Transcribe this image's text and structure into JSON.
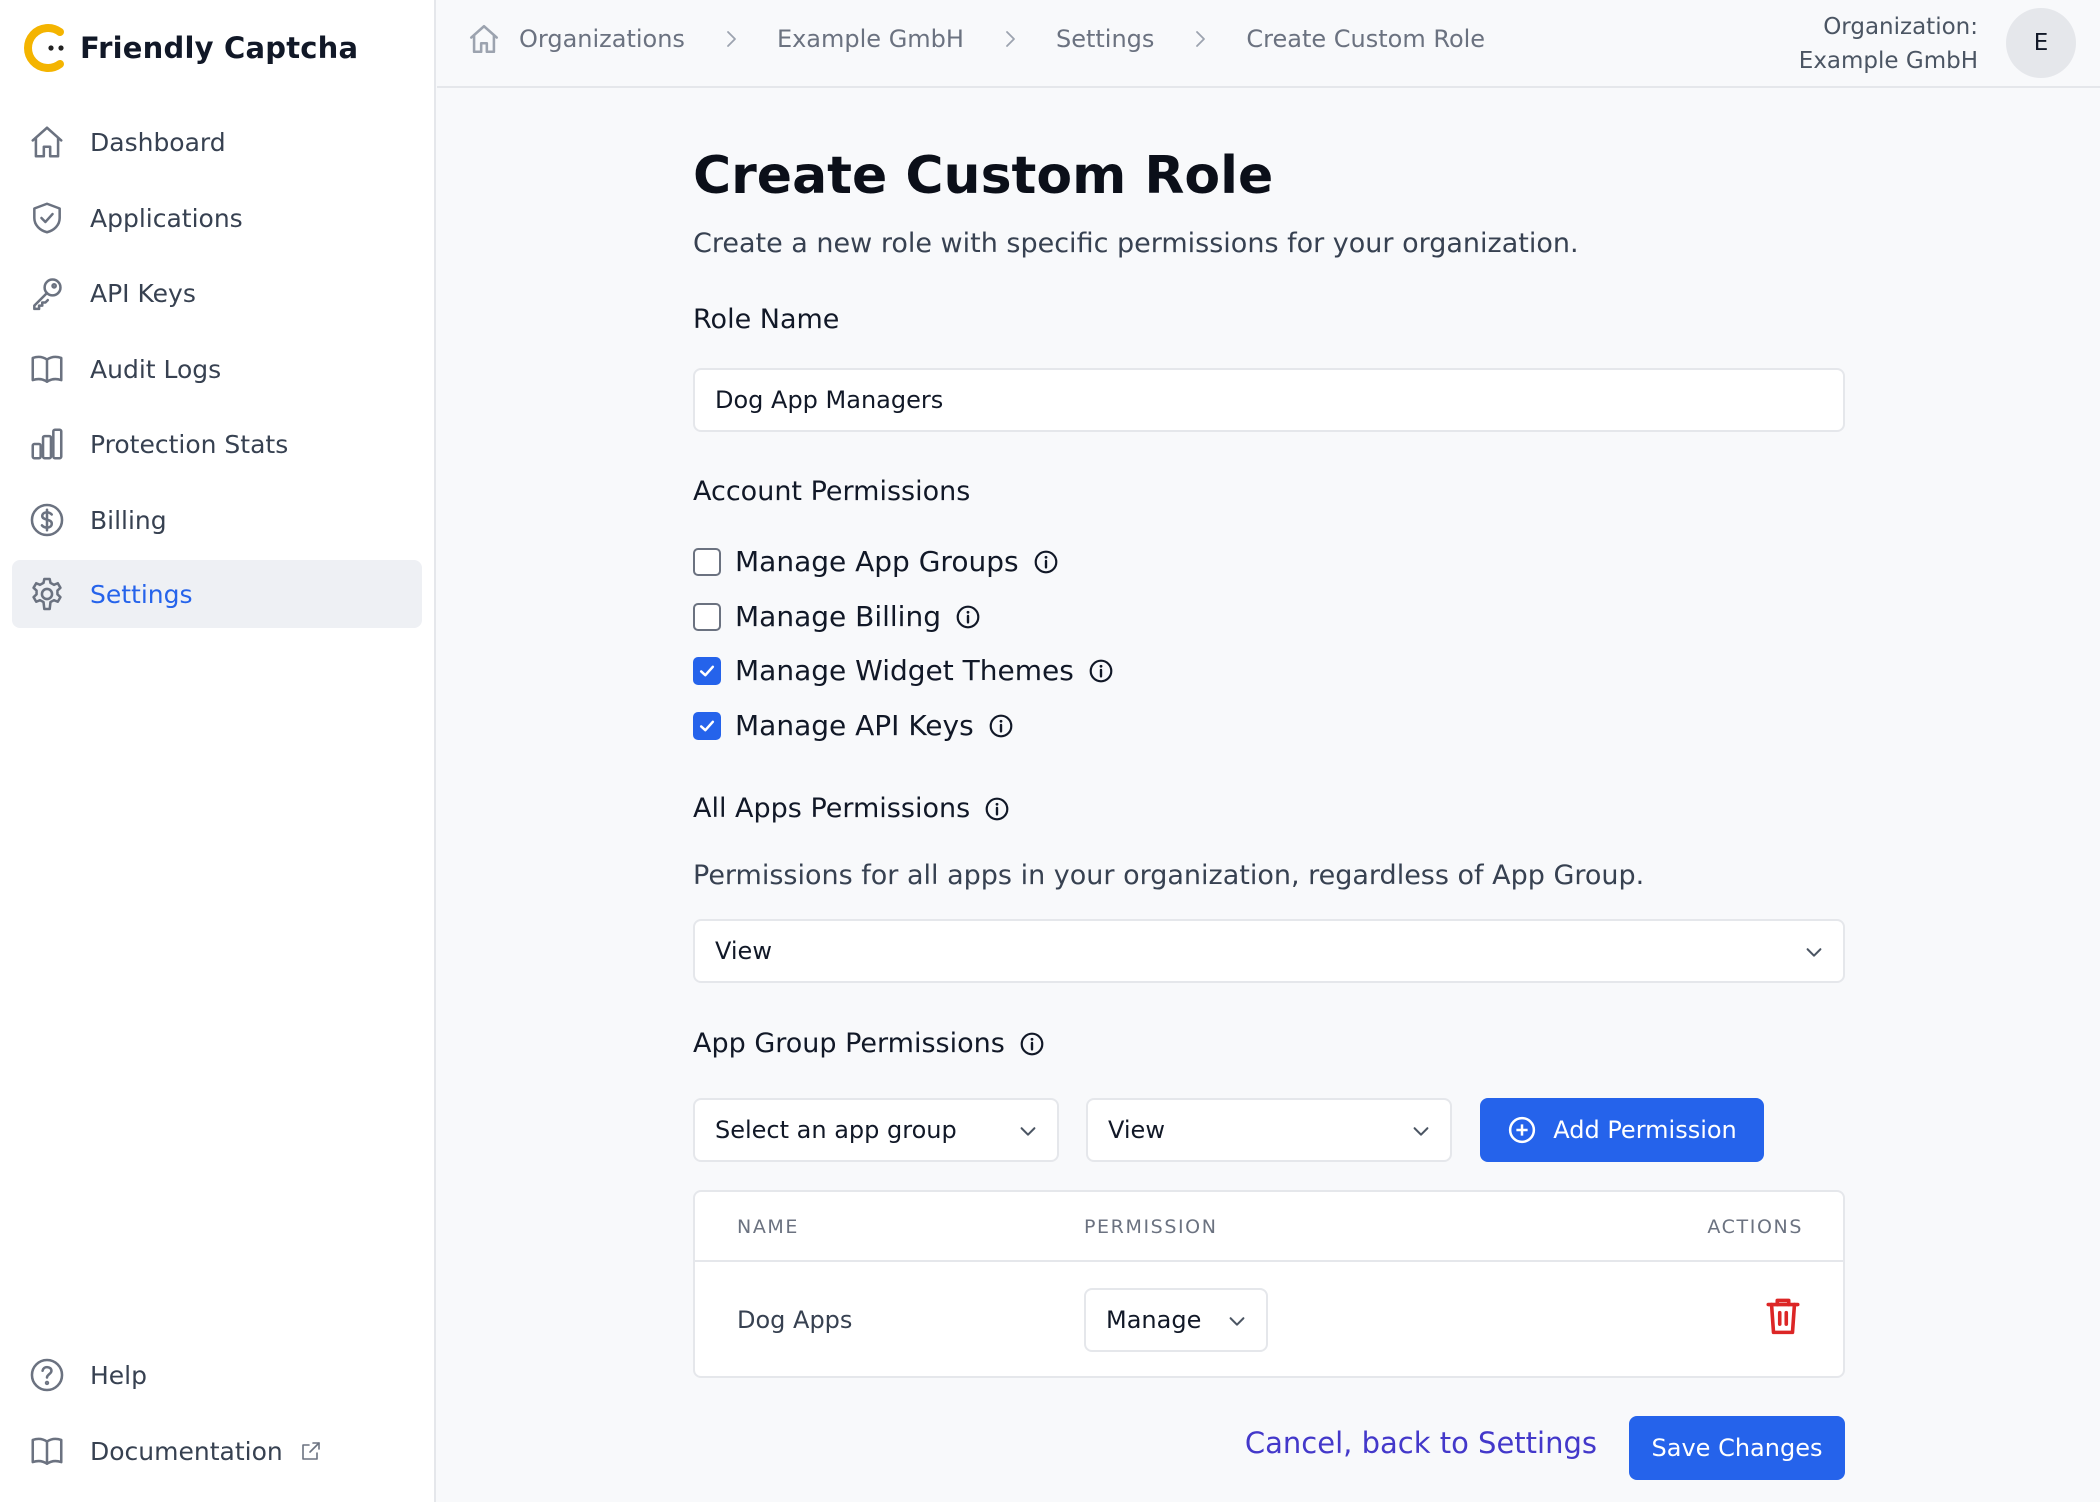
{
  "brand": {
    "name": "Friendly Captcha",
    "accent": "#f4b400"
  },
  "sidebar": {
    "items": [
      {
        "label": "Dashboard",
        "icon": "home-icon"
      },
      {
        "label": "Applications",
        "icon": "shield-check-icon"
      },
      {
        "label": "API Keys",
        "icon": "key-icon"
      },
      {
        "label": "Audit Logs",
        "icon": "book-icon"
      },
      {
        "label": "Protection Stats",
        "icon": "bar-chart-icon"
      },
      {
        "label": "Billing",
        "icon": "dollar-circle-icon"
      },
      {
        "label": "Settings",
        "icon": "gear-icon",
        "active": true
      }
    ],
    "bottom": [
      {
        "label": "Help",
        "icon": "question-circle-icon"
      },
      {
        "label": "Documentation",
        "icon": "book-icon"
      }
    ]
  },
  "breadcrumb": [
    "Organizations",
    "Example GmbH",
    "Settings",
    "Create Custom Role"
  ],
  "org": {
    "label": "Organization:",
    "name": "Example GmbH",
    "avatar_initial": "E"
  },
  "page": {
    "title": "Create Custom Role",
    "subtitle": "Create a new role with specific permissions for your organization."
  },
  "role_name": {
    "label": "Role Name",
    "value": "Dog App Managers"
  },
  "account_permissions": {
    "label": "Account Permissions",
    "items": [
      {
        "label": "Manage App Groups",
        "checked": false
      },
      {
        "label": "Manage Billing",
        "checked": false
      },
      {
        "label": "Manage Widget Themes",
        "checked": true
      },
      {
        "label": "Manage API Keys",
        "checked": true
      }
    ]
  },
  "all_apps": {
    "label": "All Apps Permissions",
    "description": "Permissions for all apps in your organization, regardless of App Group.",
    "selected": "View"
  },
  "app_group": {
    "label": "App Group Permissions",
    "group_select": "Select an app group",
    "permission_select": "View",
    "add_button": "Add Permission",
    "table": {
      "headers": [
        "NAME",
        "PERMISSION",
        "ACTIONS"
      ],
      "rows": [
        {
          "name": "Dog Apps",
          "permission": "Manage"
        }
      ]
    }
  },
  "footer": {
    "cancel": "Cancel, back to Settings",
    "save": "Save Changes"
  }
}
